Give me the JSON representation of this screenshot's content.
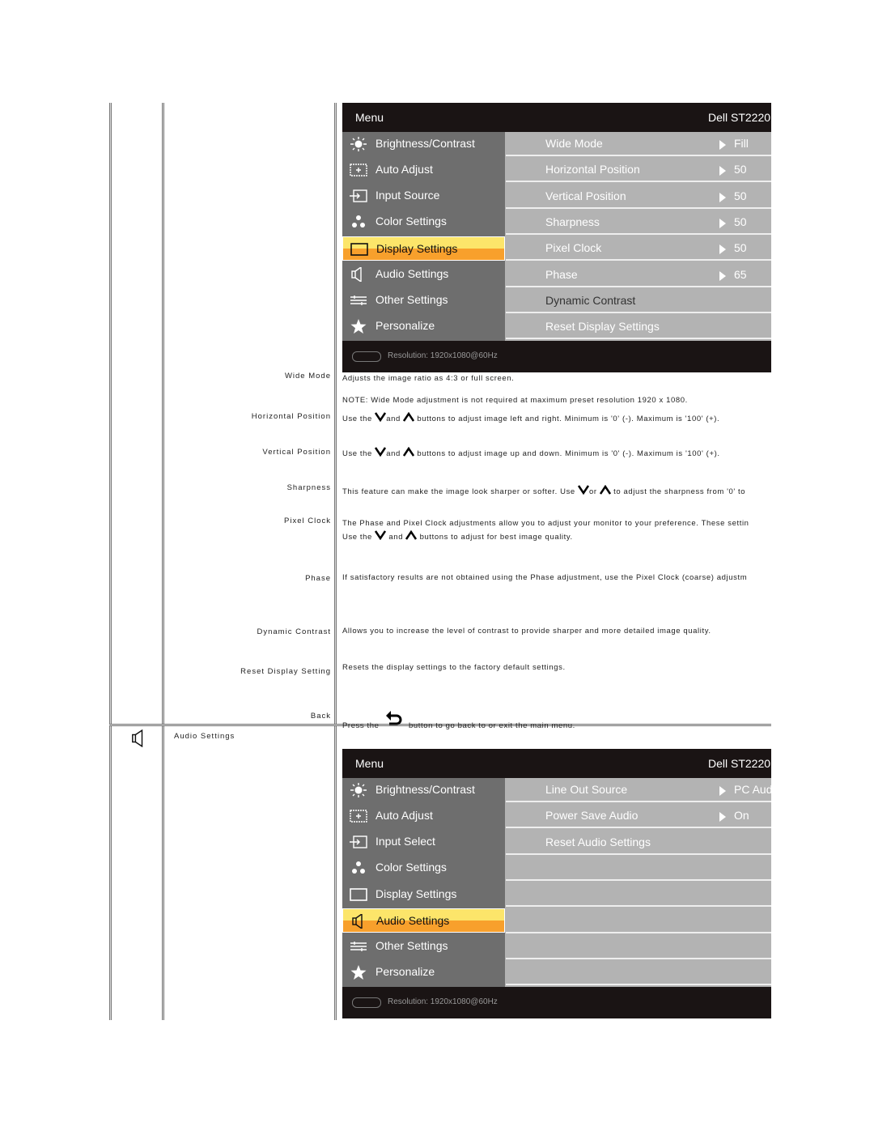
{
  "display_section": {
    "osd": {
      "menu_title": "Menu",
      "model": "Dell ST2220",
      "left_items": [
        {
          "icon": "brightness-icon",
          "label": "Brightness/Contrast"
        },
        {
          "icon": "auto-adjust-icon",
          "label": "Auto Adjust"
        },
        {
          "icon": "input-source-icon",
          "label": "Input Source"
        },
        {
          "icon": "color-settings-icon",
          "label": "Color Settings"
        },
        {
          "icon": "display-settings-icon",
          "label": "Display Settings",
          "selected": true
        },
        {
          "icon": "audio-settings-icon",
          "label": "Audio Settings"
        },
        {
          "icon": "other-settings-icon",
          "label": "Other Settings"
        },
        {
          "icon": "personalize-star-icon",
          "label": "Personalize"
        }
      ],
      "right_items": [
        {
          "label": "Wide Mode",
          "value": "Fill"
        },
        {
          "label": "Horizontal Position",
          "value": "50"
        },
        {
          "label": "Vertical Position",
          "value": "50"
        },
        {
          "label": "Sharpness",
          "value": "50"
        },
        {
          "label": "Pixel Clock",
          "value": "50"
        },
        {
          "label": "Phase",
          "value": "65"
        },
        {
          "label": "Dynamic Contrast",
          "value": ""
        },
        {
          "label": "Reset Display Settings",
          "value": ""
        }
      ],
      "resolution": "Resolution:  1920x1080@60Hz"
    },
    "rows": [
      {
        "label": "Wide Mode",
        "lines": [
          "Adjusts the image ratio as 4:3 or full screen.",
          "NOTE: Wide Mode adjustment is not required at maximum preset resolution 1920 x 1080."
        ]
      },
      {
        "label": "Horizontal Position",
        "pre": "Use the ",
        "mid": "and ",
        "post": " buttons to adjust image left and right. Minimum is '0' (-). Maximum is '100' (+)."
      },
      {
        "label": "Vertical Position",
        "pre": "Use the ",
        "mid": "and ",
        "post": " buttons to adjust image up and down. Minimum is '0' (-). Maximum is '100' (+)."
      },
      {
        "label": "Sharpness",
        "pre": "This feature can make the image look sharper or softer. Use ",
        "mid": "or ",
        "post": " to adjust the sharpness from '0' to"
      },
      {
        "label": "Pixel Clock",
        "line1": "The Phase and Pixel Clock adjustments allow you to adjust your monitor to your preference. These settin",
        "pre": "Use the ",
        "mid": " and ",
        "post": " buttons to adjust for best image quality."
      },
      {
        "label": "Phase",
        "text": "If satisfactory results are not obtained using the Phase adjustment, use the Pixel Clock (coarse) adjustm"
      },
      {
        "label": "Dynamic Contrast",
        "text": "Allows you to increase the level of contrast to provide sharper and more detailed image quality."
      },
      {
        "label": "Reset Display Setting",
        "text": "Resets the display settings to the factory default settings."
      },
      {
        "label": "Back",
        "pre": "Press the ",
        "post": " button to go back to or exit the main menu."
      }
    ]
  },
  "audio_section": {
    "title": "Audio Settings",
    "osd": {
      "menu_title": "Menu",
      "model": "Dell ST2220",
      "left_items": [
        {
          "icon": "brightness-icon",
          "label": "Brightness/Contrast"
        },
        {
          "icon": "auto-adjust-icon",
          "label": "Auto Adjust"
        },
        {
          "icon": "input-source-icon",
          "label": "Input Select"
        },
        {
          "icon": "color-settings-icon",
          "label": "Color Settings"
        },
        {
          "icon": "display-settings-icon",
          "label": "Display Settings"
        },
        {
          "icon": "audio-settings-icon",
          "label": "Audio Settings",
          "selected": true
        },
        {
          "icon": "other-settings-icon",
          "label": "Other Settings"
        },
        {
          "icon": "personalize-star-icon",
          "label": "Personalize"
        }
      ],
      "right_items": [
        {
          "label": "Line Out Source",
          "value": "PC Audio"
        },
        {
          "label": "Power Save Audio",
          "value": "On"
        },
        {
          "label": "Reset Audio Settings",
          "value": ""
        },
        {
          "label": "",
          "value": ""
        },
        {
          "label": "",
          "value": ""
        },
        {
          "label": "",
          "value": ""
        },
        {
          "label": "",
          "value": ""
        },
        {
          "label": "",
          "value": ""
        }
      ],
      "resolution": "Resolution:  1920x1080@60Hz"
    }
  }
}
